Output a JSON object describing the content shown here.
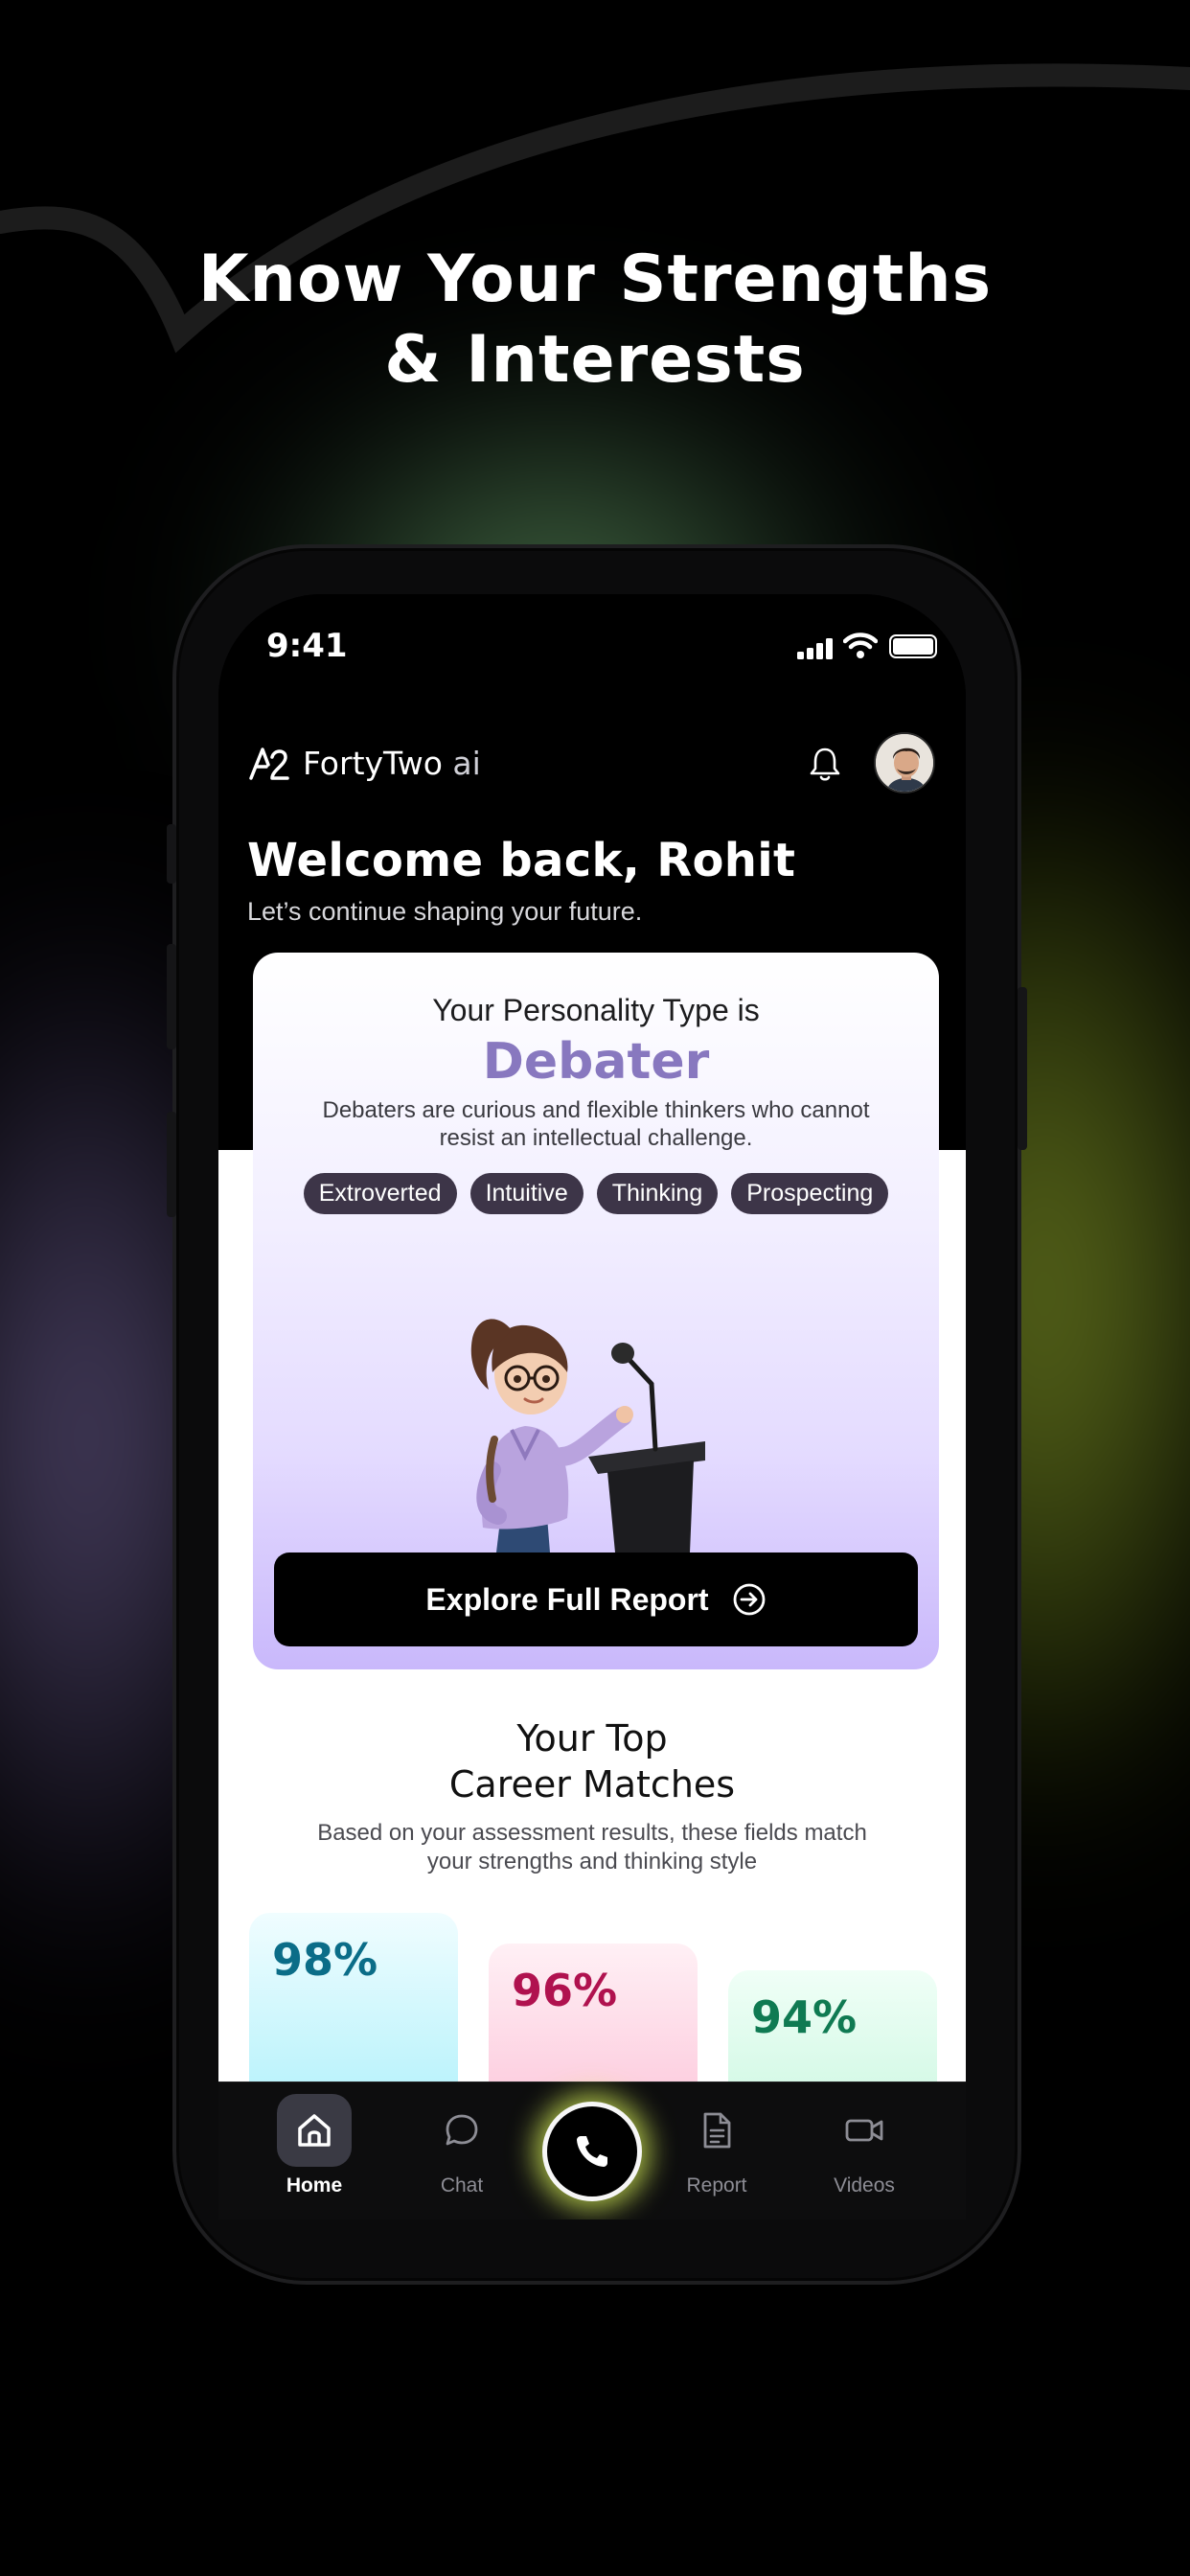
{
  "headline": {
    "line1": "Know Your Strengths",
    "line2": "& Interests"
  },
  "status_bar": {
    "time": "9:41"
  },
  "app": {
    "brand": "FortyTwo",
    "brand_suffix": "ai"
  },
  "welcome": {
    "title": "Welcome back, Rohit",
    "subtitle": "Let’s continue shaping your future."
  },
  "personality_card": {
    "heading": "Your Personality Type is",
    "type": "Debater",
    "description": "Debaters are curious and flexible thinkers who cannot resist an intellectual challenge.",
    "traits": [
      "Extroverted",
      "Intuitive",
      "Thinking",
      "Prospecting"
    ],
    "cta_label": "Explore Full Report"
  },
  "career_matches": {
    "title_line1": "Your Top",
    "title_line2": "Career Matches",
    "subtitle": "Based on your assessment results, these fields match your strengths and thinking style",
    "items": [
      {
        "percent": "98%",
        "color": "#0b6d88"
      },
      {
        "percent": "96%",
        "color": "#b0124f"
      },
      {
        "percent": "94%",
        "color": "#0f7a52"
      }
    ]
  },
  "nav": {
    "items": [
      {
        "label": "Home",
        "icon": "home-icon",
        "active": true
      },
      {
        "label": "Chat",
        "icon": "chat-icon"
      },
      {
        "label": "Report",
        "icon": "document-icon"
      },
      {
        "label": "Videos",
        "icon": "video-icon"
      }
    ],
    "center_action_icon": "phone-icon"
  },
  "colors": {
    "accent": "#8878bf",
    "tag_bg": "#3d3548",
    "call_glow": "#dcf55a"
  }
}
